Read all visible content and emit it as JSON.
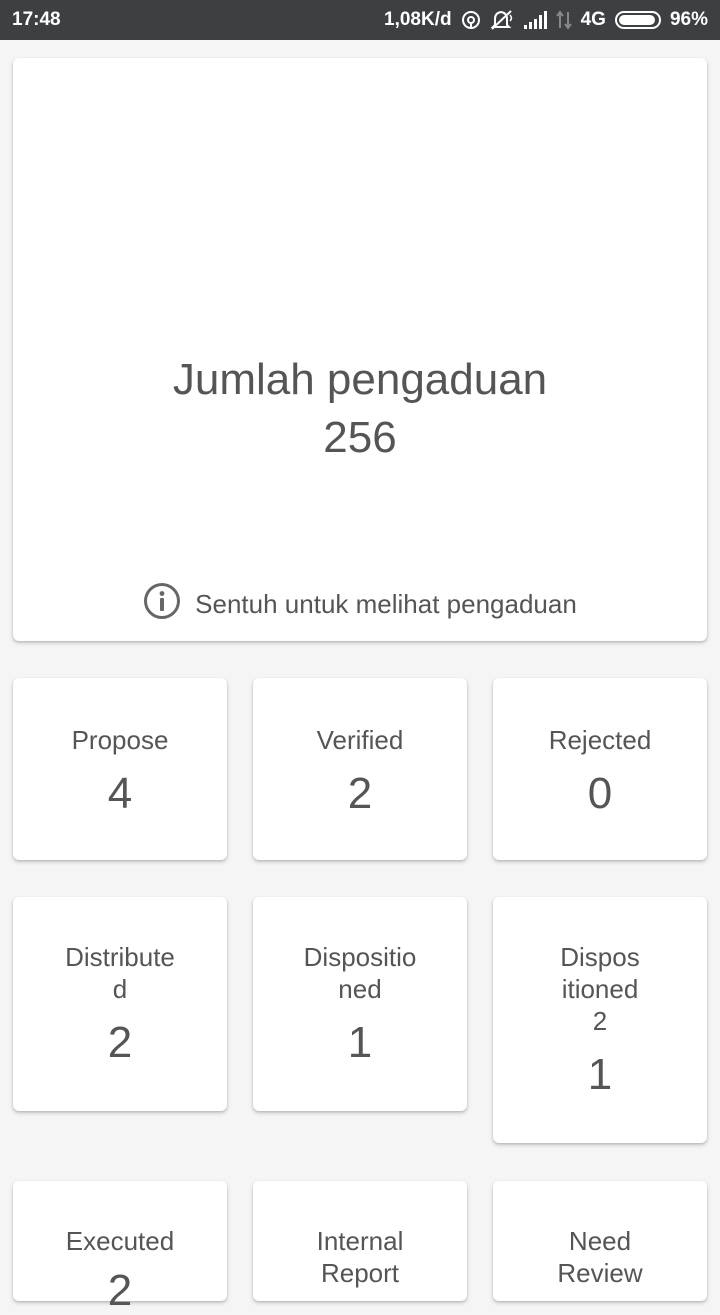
{
  "status_bar": {
    "time": "17:48",
    "network_speed": "1,08K/d",
    "network_type": "4G",
    "battery_percent": "96%",
    "battery_level": 0.96,
    "icons": [
      "hotspot-icon",
      "mute-icon",
      "signal-icon",
      "data-transfer-icon",
      "battery-icon"
    ]
  },
  "summary": {
    "title": "Jumlah pengaduan",
    "count": "256",
    "hint": "Sentuh untuk melihat pengaduan",
    "hint_icon": "info-icon"
  },
  "tiles": [
    {
      "label_lines": [
        "Propose"
      ],
      "value": "4"
    },
    {
      "label_lines": [
        "Verified"
      ],
      "value": "2"
    },
    {
      "label_lines": [
        "Rejected"
      ],
      "value": "0"
    },
    {
      "label_lines": [
        "Distribute",
        "d"
      ],
      "value": "2"
    },
    {
      "label_lines": [
        "Dispositio",
        "ned"
      ],
      "value": "1"
    },
    {
      "label_lines": [
        "Dispos",
        "itioned",
        "2"
      ],
      "value": "1"
    },
    {
      "label_lines": [
        "Executed"
      ],
      "value": "2"
    },
    {
      "label_lines": [
        "Internal",
        "Report"
      ],
      "value": ""
    },
    {
      "label_lines": [
        "Need",
        "Review"
      ],
      "value": ""
    }
  ],
  "colors": {
    "status_bar_bg": "#3d4043",
    "page_bg": "#f5f5f5",
    "card_bg": "#ffffff",
    "text": "#555555"
  }
}
